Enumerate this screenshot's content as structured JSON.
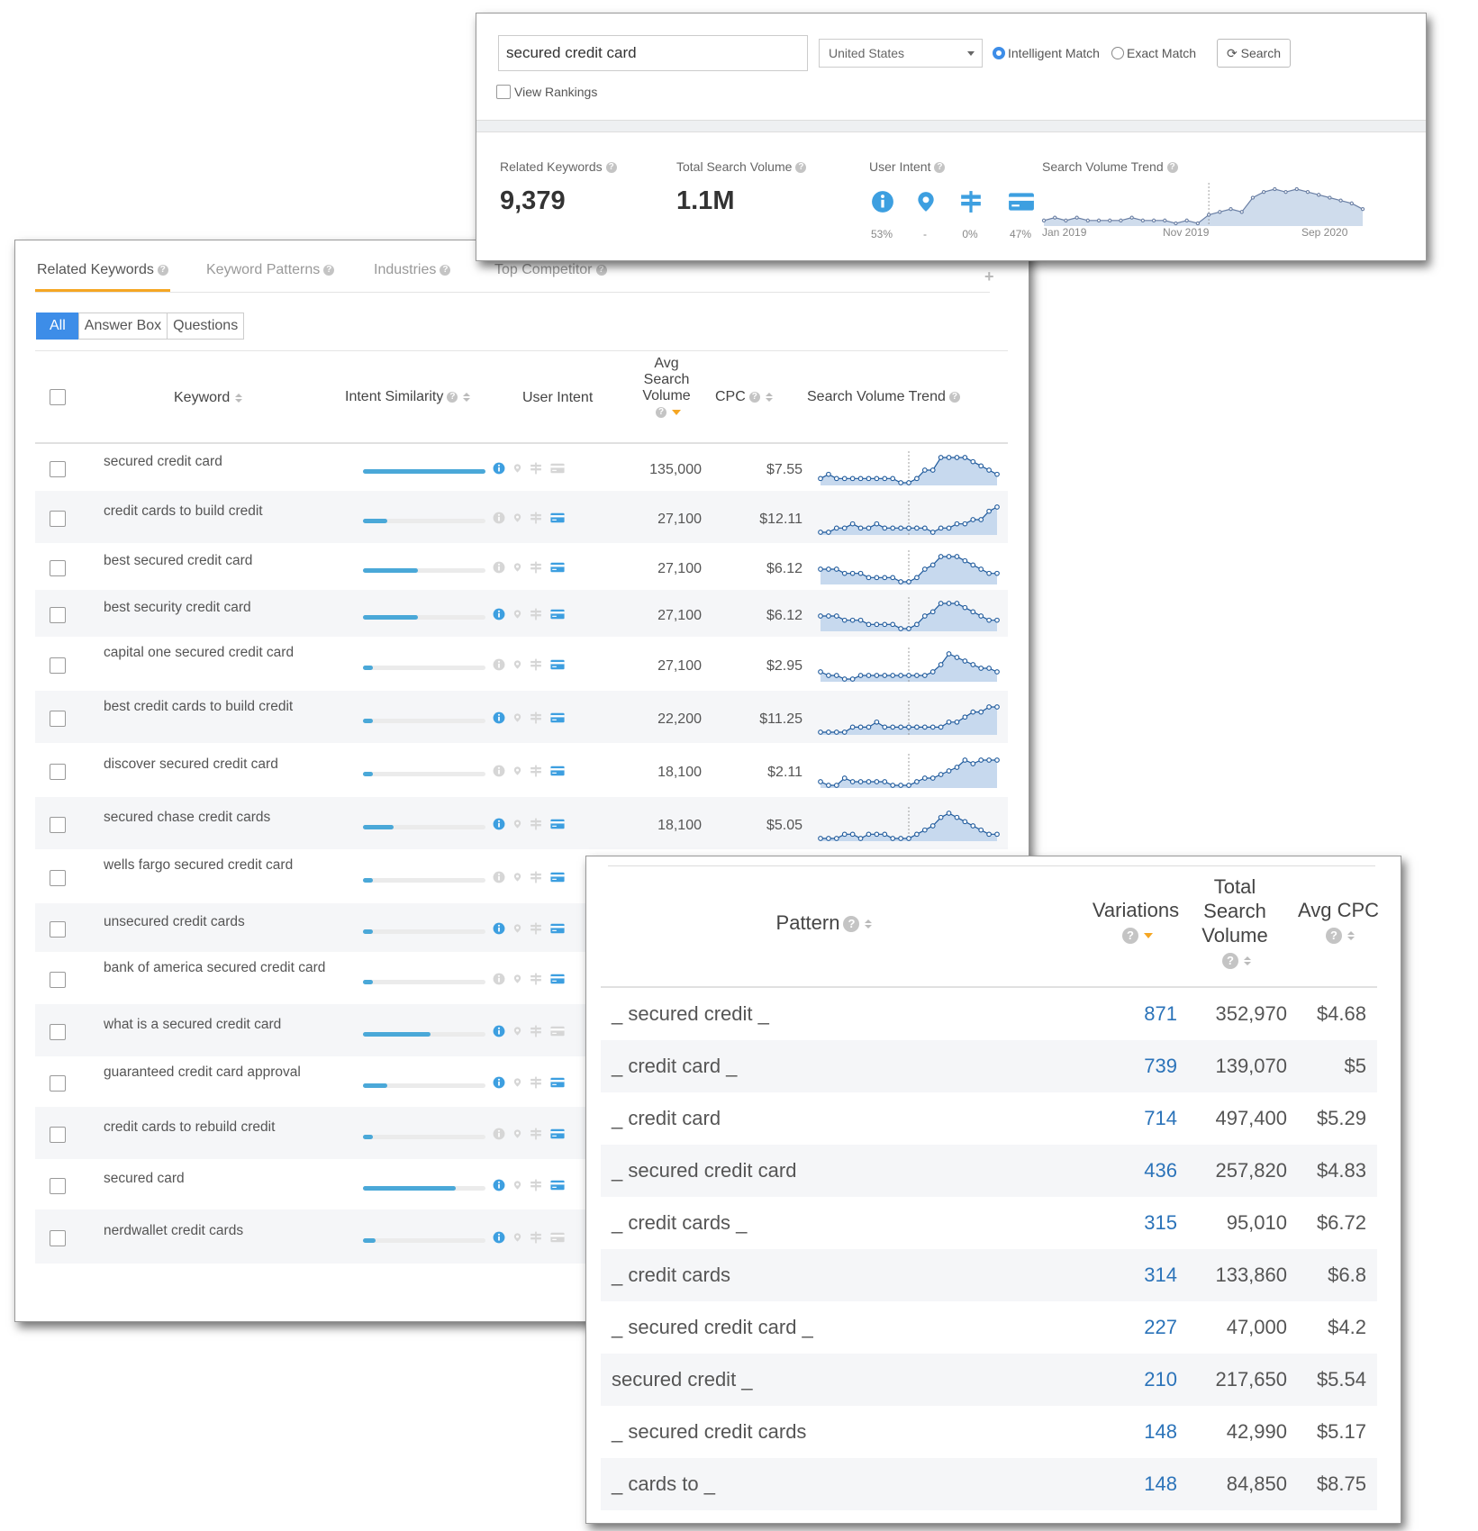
{
  "colors": {
    "accent": "#3d8de8",
    "bar": "#4aa8d8",
    "link": "#2b73b9",
    "orange": "#f5a623",
    "chart_line": "#1f5a9c",
    "chart_fill": "#c7d9ee"
  },
  "top": {
    "search_value": "secured credit card",
    "country": "United States",
    "radio_intelligent": "Intelligent Match",
    "radio_exact": "Exact Match",
    "search_button": "Search",
    "view_rankings": "View Rankings",
    "stats": {
      "related_label": "Related Keywords",
      "related_value": "9,379",
      "volume_label": "Total Search Volume",
      "volume_value": "1.1M",
      "intent_label": "User Intent",
      "intent": [
        {
          "icon": "info-icon",
          "pct": "53%"
        },
        {
          "icon": "location-pin-icon",
          "pct": "-"
        },
        {
          "icon": "signpost-icon",
          "pct": "0%"
        },
        {
          "icon": "credit-card-icon",
          "pct": "47%"
        }
      ],
      "trend_label": "Search Volume Trend",
      "trend_axis": [
        "Jan 2019",
        "Nov 2019",
        "Sep 2020"
      ],
      "trend_values": [
        52,
        53,
        52,
        53,
        52,
        52,
        52,
        52,
        53,
        52,
        52,
        52,
        51,
        52,
        51,
        54,
        55,
        56,
        55,
        60,
        62,
        63,
        62,
        63,
        62,
        61,
        60,
        59,
        58,
        56
      ]
    }
  },
  "keywords": {
    "tabs": [
      "Related Keywords",
      "Keyword Patterns",
      "Industries",
      "Top Competitor"
    ],
    "filters": [
      "All",
      "Answer Box",
      "Questions"
    ],
    "headers": {
      "keyword": "Keyword",
      "intent_similarity": "Intent Similarity",
      "user_intent": "User Intent",
      "avg_volume_1": "Avg",
      "avg_volume_2": "Search",
      "avg_volume_3": "Volume",
      "cpc": "CPC",
      "trend": "Search Volume Trend"
    },
    "rows": [
      {
        "keyword": "secured credit card",
        "similarity": 1.0,
        "intent": [
          true,
          false,
          false,
          false
        ],
        "volume": "135,000",
        "cpc": "$7.55",
        "trend": [
          6,
          7,
          6,
          6,
          6,
          6,
          6,
          6,
          6,
          6,
          5,
          5,
          6,
          8,
          8,
          11,
          11,
          11,
          11,
          10,
          9,
          8,
          7
        ]
      },
      {
        "keyword": "credit cards to build credit",
        "similarity": 0.2,
        "intent": [
          false,
          false,
          false,
          true
        ],
        "volume": "27,100",
        "cpc": "$12.11",
        "trend": [
          5,
          5,
          6,
          6,
          7,
          6,
          6,
          7,
          6,
          6,
          6,
          6,
          6,
          6,
          5,
          6,
          6,
          7,
          7,
          8,
          8,
          10,
          11
        ]
      },
      {
        "keyword": "best secured credit card",
        "similarity": 0.45,
        "intent": [
          false,
          false,
          false,
          true
        ],
        "volume": "27,100",
        "cpc": "$6.12",
        "trend": [
          8,
          8,
          8,
          7,
          7,
          7,
          6,
          6,
          6,
          6,
          5,
          5,
          6,
          8,
          9,
          11,
          11,
          11,
          10,
          9,
          8,
          7,
          7
        ]
      },
      {
        "keyword": "best security credit card",
        "similarity": 0.45,
        "intent": [
          true,
          false,
          false,
          true
        ],
        "volume": "27,100",
        "cpc": "$6.12",
        "trend": [
          8,
          8,
          8,
          7,
          7,
          7,
          6,
          6,
          6,
          6,
          5,
          5,
          6,
          8,
          9,
          11,
          11,
          11,
          10,
          9,
          8,
          7,
          7
        ]
      },
      {
        "keyword": "capital one secured credit card",
        "similarity": 0.08,
        "intent": [
          false,
          false,
          false,
          true
        ],
        "volume": "27,100",
        "cpc": "$2.95",
        "trend": [
          7,
          6,
          6,
          5,
          5,
          6,
          6,
          6,
          6,
          6,
          6,
          6,
          6,
          6,
          7,
          9,
          12,
          11,
          10,
          9,
          8,
          8,
          7
        ]
      },
      {
        "keyword": "best credit cards to build credit",
        "similarity": 0.08,
        "intent": [
          true,
          false,
          false,
          true
        ],
        "volume": "22,200",
        "cpc": "$11.25",
        "trend": [
          5,
          5,
          5,
          5,
          6,
          6,
          6,
          7,
          6,
          6,
          6,
          6,
          6,
          6,
          6,
          6,
          7,
          7,
          8,
          9,
          9,
          10,
          10
        ]
      },
      {
        "keyword": "discover secured credit card",
        "similarity": 0.08,
        "intent": [
          false,
          false,
          false,
          true
        ],
        "volume": "18,100",
        "cpc": "$2.11",
        "trend": [
          5,
          4,
          4,
          6,
          5,
          5,
          5,
          5,
          5,
          4,
          4,
          4,
          5,
          6,
          6,
          7,
          8,
          9,
          11,
          10,
          11,
          11,
          11
        ]
      },
      {
        "keyword": "secured chase credit cards",
        "similarity": 0.25,
        "intent": [
          true,
          false,
          false,
          true
        ],
        "volume": "18,100",
        "cpc": "$5.05",
        "trend": [
          5,
          5,
          5,
          6,
          6,
          5,
          6,
          6,
          6,
          5,
          5,
          5,
          6,
          7,
          8,
          10,
          11,
          10,
          9,
          8,
          7,
          6,
          6
        ]
      },
      {
        "keyword": "wells fargo secured credit card",
        "similarity": 0.08,
        "intent": [
          false,
          false,
          false,
          true
        ],
        "volume": "",
        "cpc": "",
        "trend": []
      },
      {
        "keyword": "unsecured credit cards",
        "similarity": 0.08,
        "intent": [
          true,
          false,
          false,
          true
        ],
        "volume": "",
        "cpc": "",
        "trend": []
      },
      {
        "keyword": "bank of america secured credit card",
        "similarity": 0.08,
        "intent": [
          false,
          false,
          false,
          true
        ],
        "volume": "",
        "cpc": "",
        "trend": []
      },
      {
        "keyword": "what is a secured credit card",
        "similarity": 0.55,
        "intent": [
          true,
          false,
          false,
          false
        ],
        "volume": "",
        "cpc": "",
        "trend": []
      },
      {
        "keyword": "guaranteed credit card approval",
        "similarity": 0.2,
        "intent": [
          true,
          false,
          false,
          true
        ],
        "volume": "",
        "cpc": "",
        "trend": []
      },
      {
        "keyword": "credit cards to rebuild credit",
        "similarity": 0.08,
        "intent": [
          false,
          false,
          false,
          true
        ],
        "volume": "",
        "cpc": "",
        "trend": []
      },
      {
        "keyword": "secured card",
        "similarity": 0.76,
        "intent": [
          true,
          false,
          false,
          true
        ],
        "volume": "",
        "cpc": "",
        "trend": []
      },
      {
        "keyword": "nerdwallet credit cards",
        "similarity": 0.1,
        "intent": [
          true,
          false,
          false,
          false
        ],
        "volume": "",
        "cpc": "",
        "trend": []
      }
    ]
  },
  "patterns": {
    "headers": {
      "pattern": "Pattern",
      "variations": "Variations",
      "volume_1": "Total",
      "volume_2": "Search",
      "volume_3": "Volume",
      "cpc": "Avg CPC"
    },
    "rows": [
      {
        "pattern": "_ secured credit _",
        "variations": "871",
        "volume": "352,970",
        "cpc": "$4.68"
      },
      {
        "pattern": "_ credit card _",
        "variations": "739",
        "volume": "139,070",
        "cpc": "$5"
      },
      {
        "pattern": "_ credit card",
        "variations": "714",
        "volume": "497,400",
        "cpc": "$5.29"
      },
      {
        "pattern": "_ secured credit card",
        "variations": "436",
        "volume": "257,820",
        "cpc": "$4.83"
      },
      {
        "pattern": "_ credit cards _",
        "variations": "315",
        "volume": "95,010",
        "cpc": "$6.72"
      },
      {
        "pattern": "_ credit cards",
        "variations": "314",
        "volume": "133,860",
        "cpc": "$6.8"
      },
      {
        "pattern": "_ secured credit card _",
        "variations": "227",
        "volume": "47,000",
        "cpc": "$4.2"
      },
      {
        "pattern": "secured credit _",
        "variations": "210",
        "volume": "217,650",
        "cpc": "$5.54"
      },
      {
        "pattern": "_ secured credit cards",
        "variations": "148",
        "volume": "42,990",
        "cpc": "$5.17"
      },
      {
        "pattern": "_ cards to _",
        "variations": "148",
        "volume": "84,850",
        "cpc": "$8.75"
      }
    ]
  }
}
